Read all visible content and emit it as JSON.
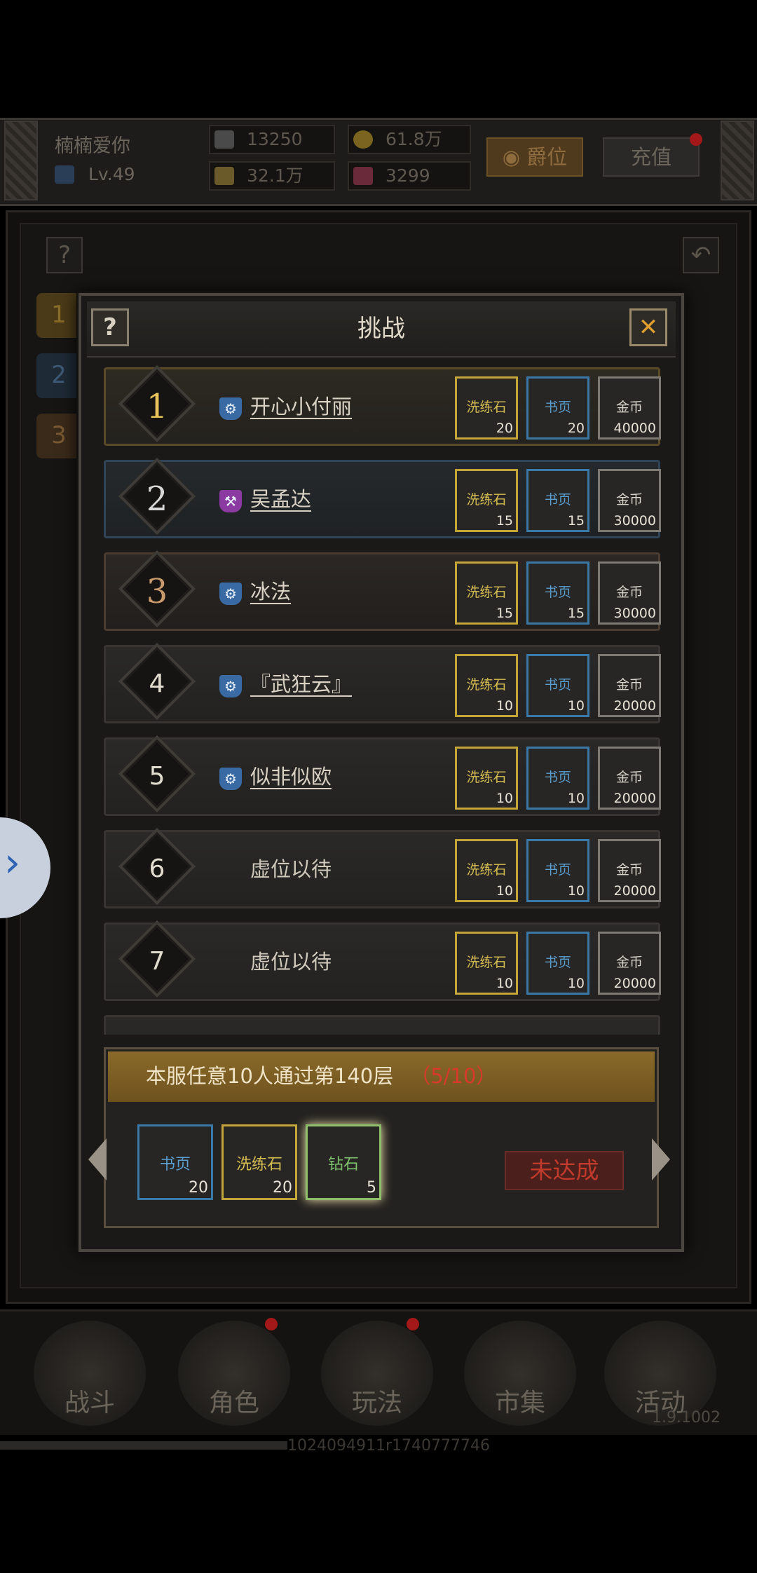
{
  "top_bar": {
    "player_name": "楠楠爱你",
    "level": "Lv.49",
    "combat_power": "13250",
    "gold": "61.8万",
    "hp": "32.1万",
    "gems": "3299",
    "title_button": "爵位",
    "recharge_button": "充值"
  },
  "background_tabs": [
    "1",
    "2",
    "3"
  ],
  "dialog": {
    "title": "挑战",
    "help_glyph": "?",
    "close_glyph": "✕",
    "rows": [
      {
        "rank": "1",
        "name": "开心小付丽",
        "class_icon": "wrench-blue-icon",
        "rewards": [
          {
            "name": "洗练石",
            "count": "20"
          },
          {
            "name": "书页",
            "count": "20"
          },
          {
            "name": "金币",
            "count": "40000"
          }
        ]
      },
      {
        "rank": "2",
        "name": "吴孟达",
        "class_icon": "hammer-purple-icon",
        "rewards": [
          {
            "name": "洗练石",
            "count": "15"
          },
          {
            "name": "书页",
            "count": "15"
          },
          {
            "name": "金币",
            "count": "30000"
          }
        ]
      },
      {
        "rank": "3",
        "name": "冰法",
        "class_icon": "wrench-blue-icon",
        "rewards": [
          {
            "name": "洗练石",
            "count": "15"
          },
          {
            "name": "书页",
            "count": "15"
          },
          {
            "name": "金币",
            "count": "30000"
          }
        ]
      },
      {
        "rank": "4",
        "name": "『武狂云』",
        "class_icon": "wrench-blue-icon",
        "rewards": [
          {
            "name": "洗练石",
            "count": "10"
          },
          {
            "name": "书页",
            "count": "10"
          },
          {
            "name": "金币",
            "count": "20000"
          }
        ]
      },
      {
        "rank": "5",
        "name": "似非似欧",
        "class_icon": "wrench-blue-icon",
        "rewards": [
          {
            "name": "洗练石",
            "count": "10"
          },
          {
            "name": "书页",
            "count": "10"
          },
          {
            "name": "金币",
            "count": "20000"
          }
        ]
      },
      {
        "rank": "6",
        "name": "虚位以待",
        "class_icon": "",
        "rewards": [
          {
            "name": "洗练石",
            "count": "10"
          },
          {
            "name": "书页",
            "count": "10"
          },
          {
            "name": "金币",
            "count": "20000"
          }
        ]
      },
      {
        "rank": "7",
        "name": "虚位以待",
        "class_icon": "",
        "rewards": [
          {
            "name": "洗练石",
            "count": "10"
          },
          {
            "name": "书页",
            "count": "10"
          },
          {
            "name": "金币",
            "count": "20000"
          }
        ]
      }
    ]
  },
  "quest": {
    "text": "本服任意10人通过第140层",
    "progress": "（5/10）",
    "rewards": [
      {
        "name": "书页",
        "count": "20"
      },
      {
        "name": "洗练石",
        "count": "20"
      },
      {
        "name": "钻石",
        "count": "5"
      }
    ],
    "status_button": "未达成"
  },
  "bottom_nav": [
    "战斗",
    "角色",
    "玩法",
    "市集",
    "活动"
  ],
  "version": "1.9.1002",
  "build_id": "1024094911r1740777746",
  "colors": {
    "gold_accent": "#c4a53a",
    "book_blue": "#3a78a8",
    "progress_red": "#d83a2a",
    "quest_bar": "#8a6a2a"
  }
}
